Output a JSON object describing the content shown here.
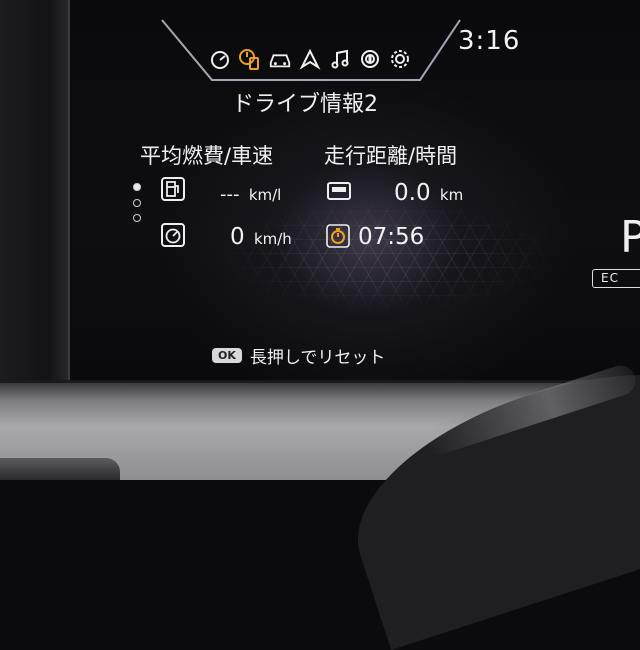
{
  "clock": "3:16",
  "title": "ドライブ情報2",
  "icons": [
    "speedometer-icon",
    "fuel-timer-icon",
    "car-icon",
    "navigation-icon",
    "music-icon",
    "assist-icon",
    "settings-icon"
  ],
  "colors": {
    "accent": "#f0a020",
    "text": "#f0f0f0"
  },
  "headers": {
    "left": "平均燃費/車速",
    "right": "走行距離/時間"
  },
  "stats": {
    "fuel_economy": {
      "value": "---",
      "unit": "km/l"
    },
    "avg_speed": {
      "value": "0",
      "unit": "km/h"
    },
    "distance": {
      "value": "0.0",
      "unit": "km"
    },
    "time": {
      "value": "07:56"
    }
  },
  "page_indicator": {
    "total": 3,
    "active": 1
  },
  "ok_hint": {
    "button": "OK",
    "text": "長押しでリセット"
  },
  "edge": {
    "letter": "P",
    "badge": "EC"
  }
}
